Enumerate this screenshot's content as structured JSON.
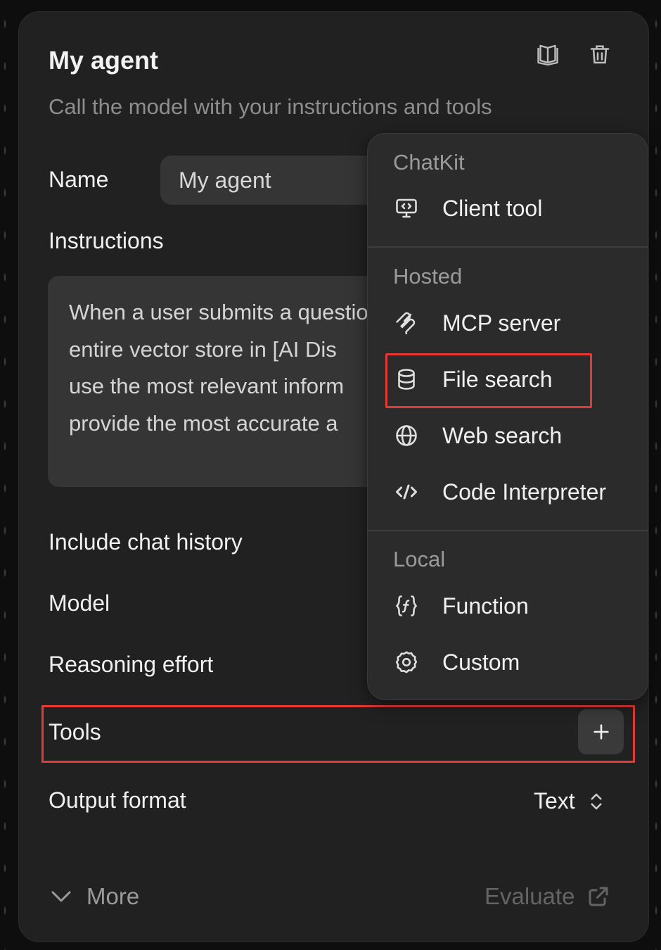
{
  "panel": {
    "title": "My agent",
    "subtitle": "Call the model with your instructions and tools"
  },
  "header_icons": {
    "docs": "book-icon",
    "delete": "trash-icon"
  },
  "form": {
    "name_label": "Name",
    "name_value": "My agent",
    "instructions_label": "Instructions",
    "instructions_lines": [
      "When a user submits a question, search the",
      "entire vector store in [AI Dis",
      "use the most relevant inform",
      "provide the most accurate a"
    ],
    "include_history_label": "Include chat history",
    "model_label": "Model",
    "reasoning_label": "Reasoning effort",
    "tools_label": "Tools",
    "add_tool_icon": "plus-icon",
    "output_format_label": "Output format",
    "output_format_value": "Text"
  },
  "footer": {
    "more_label": "More",
    "evaluate_label": "Evaluate"
  },
  "menu": {
    "sections": [
      {
        "heading": "ChatKit",
        "items": [
          {
            "label": "Client tool",
            "icon": "monitor-code-icon"
          }
        ]
      },
      {
        "heading": "Hosted",
        "items": [
          {
            "label": "MCP server",
            "icon": "mcp-icon"
          },
          {
            "label": "File search",
            "icon": "database-icon"
          },
          {
            "label": "Web search",
            "icon": "globe-icon"
          },
          {
            "label": "Code Interpreter",
            "icon": "code-icon"
          }
        ]
      },
      {
        "heading": "Local",
        "items": [
          {
            "label": "Function",
            "icon": "function-icon"
          },
          {
            "label": "Custom",
            "icon": "gear-icon"
          }
        ]
      }
    ]
  },
  "colors": {
    "highlight": "#e53935",
    "panel_bg": "#212121",
    "menu_bg": "#2b2b2b"
  }
}
